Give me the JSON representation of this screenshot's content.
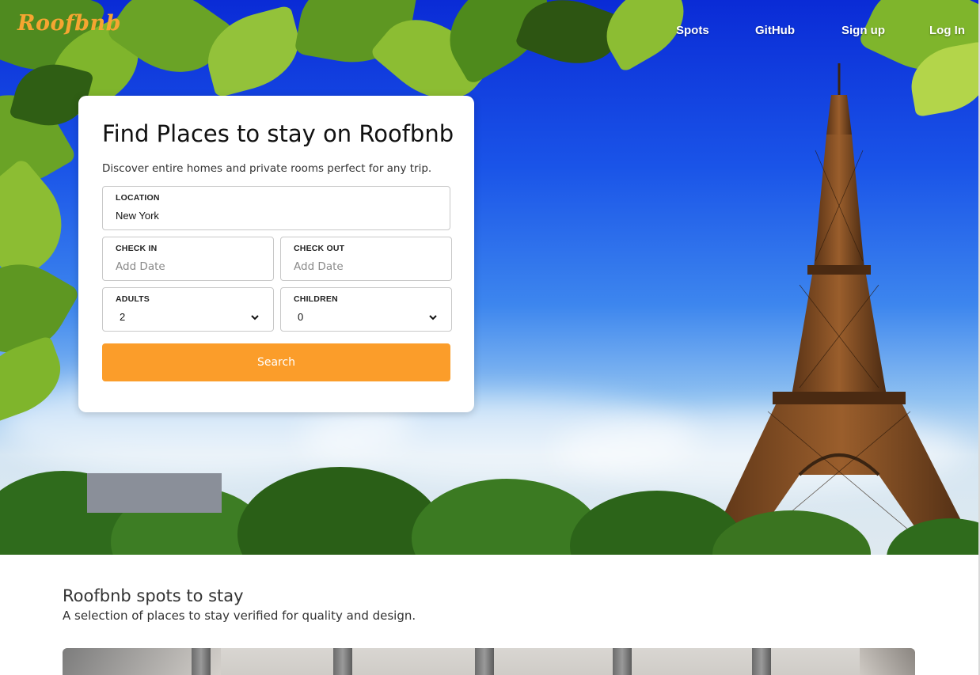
{
  "brand": {
    "logo": "Roofbnb",
    "accent": "#fb9d2a",
    "logo_color": "#f6a531"
  },
  "nav": {
    "links": [
      {
        "label": "Spots"
      },
      {
        "label": "GitHub"
      },
      {
        "label": "Sign up"
      },
      {
        "label": "Log In"
      }
    ]
  },
  "hero": {
    "image": "eiffel-tower-photo"
  },
  "search_card": {
    "title": "Find Places to stay on Roofbnb",
    "subtitle": "Discover entire homes and private rooms perfect for any trip.",
    "location": {
      "label": "LOCATION",
      "value": "New York"
    },
    "check_in": {
      "label": "CHECK IN",
      "placeholder": "Add Date"
    },
    "check_out": {
      "label": "CHECK OUT",
      "placeholder": "Add Date"
    },
    "adults": {
      "label": "ADULTS",
      "value": "2"
    },
    "children": {
      "label": "CHILDREN",
      "value": "0"
    },
    "search_button": "Search"
  },
  "spots_section": {
    "title": "Roofbnb spots to stay",
    "subtitle": "A selection of places to stay verified for quality and design."
  }
}
